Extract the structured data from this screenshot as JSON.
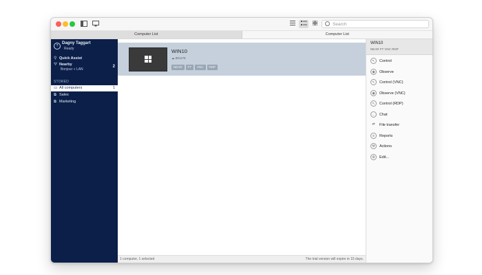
{
  "titlebar": {
    "search_placeholder": "Search"
  },
  "tabs": [
    {
      "label": "Computer List"
    },
    {
      "label": "Computer List"
    }
  ],
  "sidebar": {
    "user": {
      "name": "Dagny Taggart",
      "status": "Ready"
    },
    "quick_assist": "Quick Assist",
    "nearby": {
      "label": "Nearby",
      "sub": "Bonjour + LAN",
      "count": "2"
    },
    "stored_header": "STORED",
    "groups": [
      {
        "label": "All computers",
        "count": "1"
      },
      {
        "label": "Sales"
      },
      {
        "label": "Marketing"
      }
    ]
  },
  "main": {
    "computer": {
      "name": "WIN10",
      "id": "801178",
      "tags": [
        "NEAR",
        "FT",
        "VNC",
        "RDP"
      ]
    },
    "status_left": "1 computer, 1 selected",
    "status_right": "The trial version will expire in 15 days."
  },
  "right_panel": {
    "title": "WIN10",
    "subtitle": "NEAR FT VNC RDP",
    "actions": [
      {
        "label": "Control",
        "icon": "cursor-icon"
      },
      {
        "label": "Observe",
        "icon": "eye-icon"
      },
      {
        "label": "Control (VNC)",
        "icon": "cursor-icon"
      },
      {
        "label": "Observe (VNC)",
        "icon": "eye-icon"
      },
      {
        "label": "Control (RDP)",
        "icon": "cursor-icon"
      },
      {
        "label": "Chat",
        "icon": "chat-bubble-icon"
      },
      {
        "label": "File transfer",
        "icon": "file-transfer-icon"
      },
      {
        "label": "Reports",
        "icon": "reports-icon"
      },
      {
        "label": "Actions",
        "icon": "wrench-icon"
      },
      {
        "label": "Edit...",
        "icon": "gear-icon"
      }
    ]
  }
}
